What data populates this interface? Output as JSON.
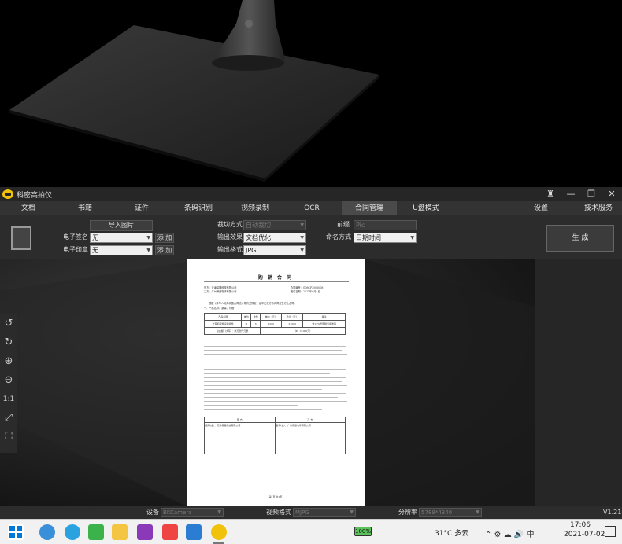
{
  "app": {
    "title": "科密高拍仪",
    "window_buttons": [
      "shirt-icon",
      "minimize-icon",
      "restore-icon",
      "close-icon"
    ]
  },
  "menu": {
    "tabs": [
      {
        "label": "文档"
      },
      {
        "label": "书籍"
      },
      {
        "label": "证件"
      },
      {
        "label": "条码识别"
      },
      {
        "label": "视频录制"
      },
      {
        "label": "OCR"
      },
      {
        "label": "合同管理"
      },
      {
        "label": "U盘模式"
      },
      {
        "label": "设置"
      },
      {
        "label": "技术服务"
      }
    ],
    "active_tab": "合同管理"
  },
  "panel": {
    "import_button": "导入图片",
    "esign_label": "电子签名",
    "esign_value": "无",
    "esign_add": "添 加",
    "eseal_label": "电子印章",
    "eseal_value": "无",
    "eseal_add": "添 加",
    "crop_label": "裁切方式",
    "crop_value": "自动裁切",
    "output_effect_label": "输出效果",
    "output_effect_value": "文档优化",
    "output_format_label": "输出格式",
    "output_format_value": "JPG",
    "prefix_label": "前缀",
    "prefix_value": "Pic",
    "naming_label": "命名方式",
    "naming_value": "日期时间",
    "generate_button": "生 成"
  },
  "left_tools": [
    "rotate-left-icon",
    "rotate-right-icon",
    "zoom-in-icon",
    "zoom-out-icon",
    "actual-size-icon",
    "fit-screen-icon",
    "fullscreen-icon"
  ],
  "left_tools_text": {
    "actual_size": "1:1"
  },
  "document": {
    "title": "购 销 合 同",
    "party_a": "甲方：天津易雕科技有限公司",
    "party_b": "乙方：广州博道电子有限公司",
    "contract_no": "合同编号：G08CF2006008",
    "sign_date": "签订日期：2021年6月4日",
    "intro": "根据《中华人民共和国合同法》等有关规定，经甲乙双方协商同意签订此合同。",
    "item1": "一、产品名称、数量、价格：",
    "table_headers": [
      "产品名称",
      "单位",
      "数量",
      "单价（元）",
      "合计（元）",
      "备注"
    ],
    "table_row": [
      "计算机存储设备组件",
      "台",
      "5",
      "6200",
      "31000",
      "含13%增值税专用发票"
    ],
    "table_total": "总金额（大写）：叁万壹仟元整",
    "table_total_small": "（¥：31000元）",
    "party_a_sign": "名称(章)：天津易雕科技有限公司",
    "party_b_sign": "名称(章)：广州博道电子有限公司",
    "sign_header_a": "甲  方",
    "sign_header_b": "乙  方",
    "footer": "第1页 共1页"
  },
  "statusbar": {
    "device_label": "设备",
    "device_value": "BKCamera",
    "video_format_label": "视频格式",
    "video_format_value": "MJPG",
    "resolution_label": "分辨率",
    "resolution_value": "5788*4340",
    "version": "V1.21"
  },
  "taskbar": {
    "battery": "100%",
    "weather": "31°C 多云",
    "time": "17:06",
    "date": "2021-07-02"
  }
}
